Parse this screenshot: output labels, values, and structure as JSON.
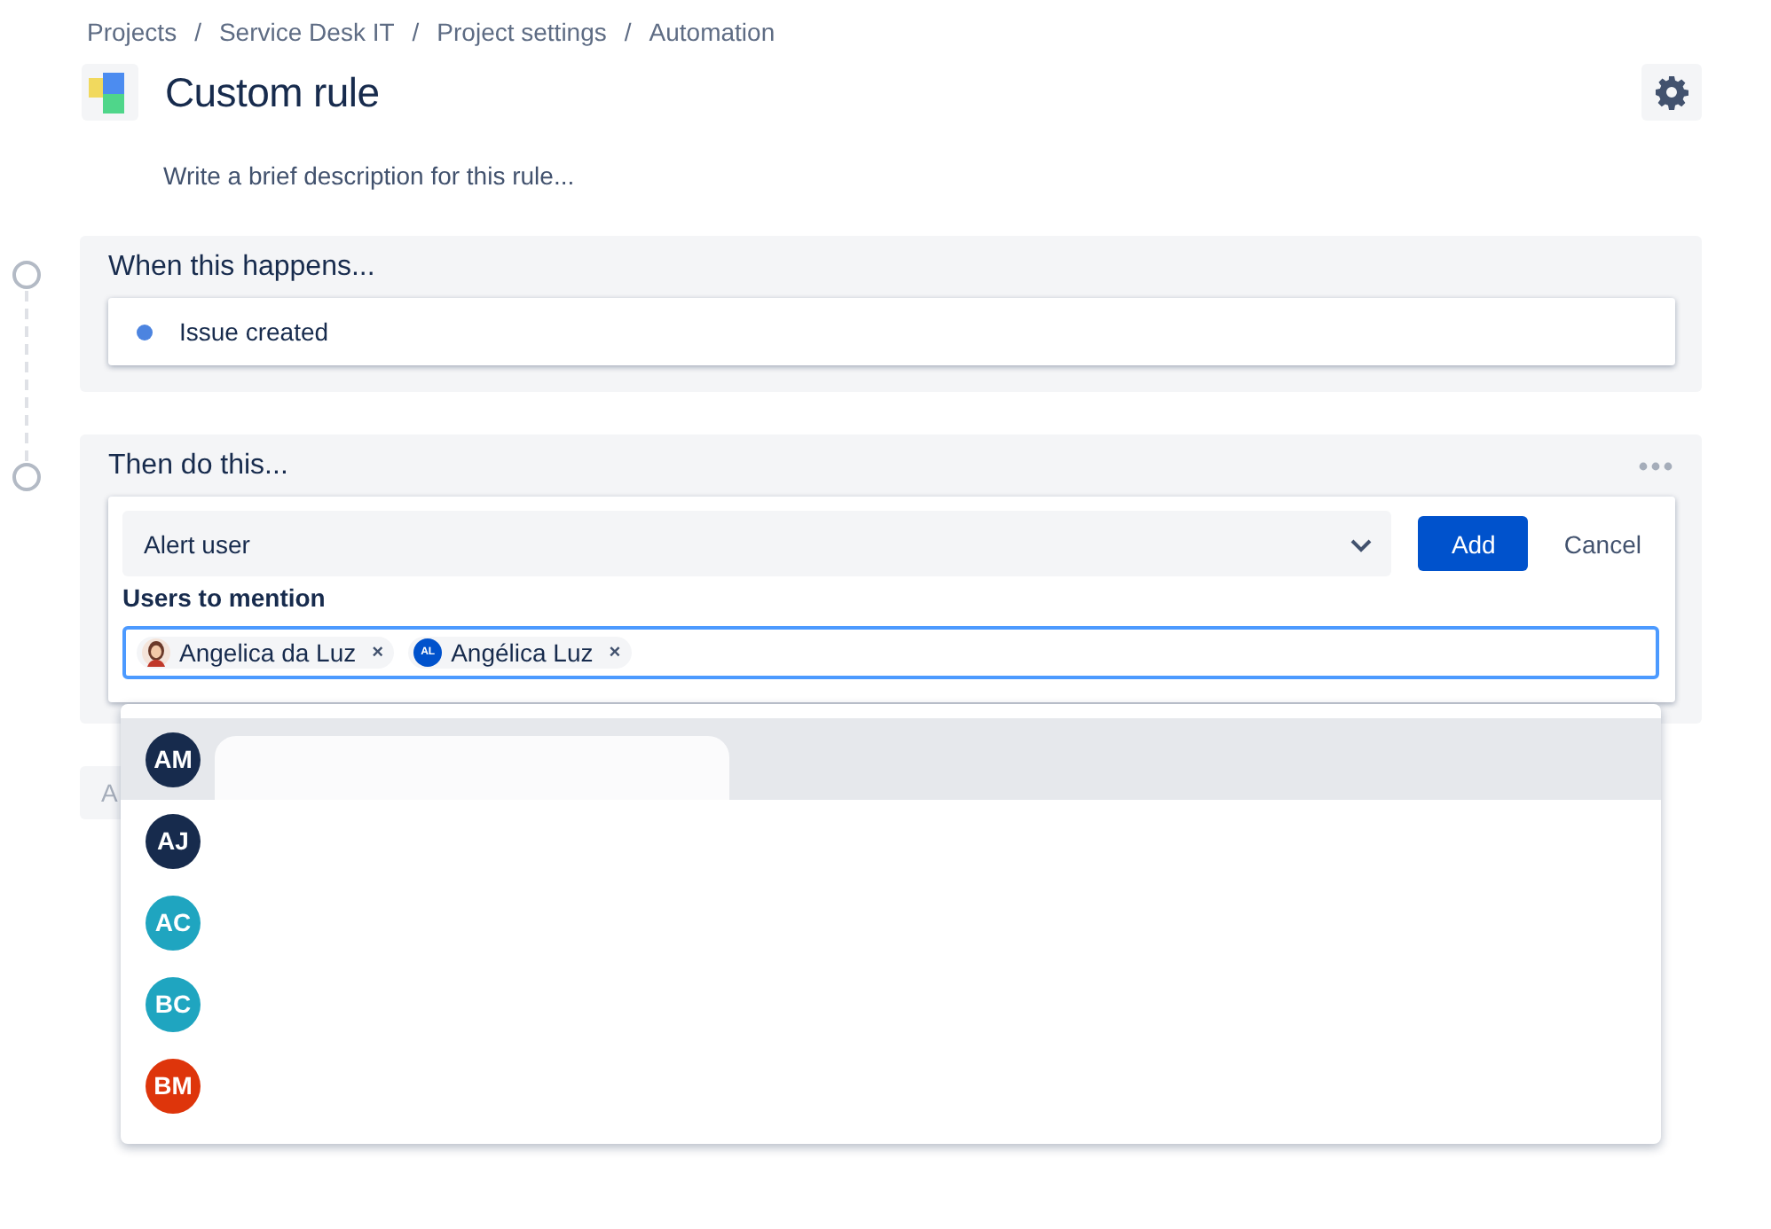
{
  "breadcrumbs": [
    "Projects",
    "Service Desk IT",
    "Project settings",
    "Automation"
  ],
  "breadcrumb_separator": "/",
  "rule": {
    "title": "Custom rule",
    "description_placeholder": "Write a brief description for this rule..."
  },
  "trigger": {
    "heading": "When this happens...",
    "item": "Issue created",
    "color": "#4c84e0"
  },
  "action": {
    "heading": "Then do this...",
    "select_value": "Alert user",
    "add_button": "Add",
    "cancel_button": "Cancel",
    "field_label": "Users to mention",
    "chips": [
      {
        "kind": "photo",
        "name": "Angelica da Luz",
        "remove": "×"
      },
      {
        "kind": "initials",
        "initials": "AL",
        "name": "Angélica Luz",
        "remove": "×",
        "color": "#0052cc"
      }
    ]
  },
  "add_component_button": "A",
  "suggestions": [
    {
      "initials": "AM",
      "color": "#172b4d",
      "selected": true
    },
    {
      "initials": "AJ",
      "color": "#172b4d",
      "selected": false
    },
    {
      "initials": "AC",
      "color": "#1fa5c0",
      "selected": false
    },
    {
      "initials": "BC",
      "color": "#1fa5c0",
      "selected": false
    },
    {
      "initials": "BM",
      "color": "#de350b",
      "selected": false
    }
  ]
}
